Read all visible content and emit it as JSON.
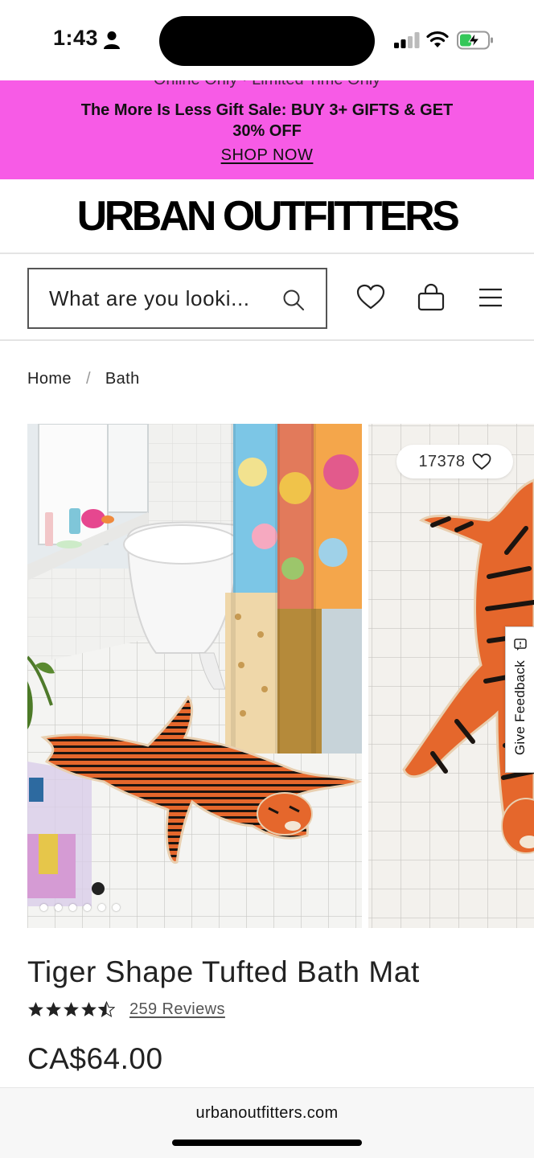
{
  "status_bar": {
    "time": "1:43",
    "icons": [
      "person-icon",
      "signal-icon",
      "wifi-icon",
      "battery-charging-icon"
    ]
  },
  "promo": {
    "previous_text": "Online Only · Limited Time Only",
    "text": "The More Is Less Gift Sale: BUY 3+ GIFTS & GET 30% OFF",
    "link": "SHOP NOW",
    "background": "#f75be6"
  },
  "header": {
    "logo": "URBAN OUTFITTERS",
    "search_placeholder": "What are you looki...",
    "icons": [
      "search-icon",
      "heart-icon",
      "shopping-bag-icon",
      "menu-icon"
    ]
  },
  "breadcrumb": {
    "items": [
      "Home",
      "Bath"
    ],
    "separator": "/"
  },
  "gallery": {
    "wishlist_count": "17378",
    "image_count": 6,
    "active_index": 0,
    "feedback_label": "Give Feedback"
  },
  "product": {
    "title": "Tiger Shape Tufted Bath Mat",
    "rating": 4.5,
    "reviews": "259 Reviews",
    "price": "CA$64.00"
  },
  "browser": {
    "url": "urbanoutfitters.com"
  }
}
